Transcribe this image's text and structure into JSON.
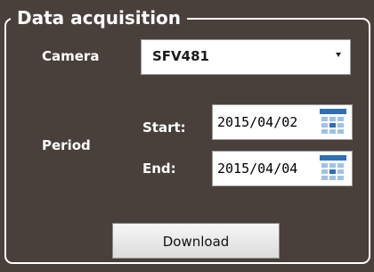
{
  "group": {
    "title": "Data acquisition"
  },
  "camera": {
    "label": "Camera",
    "selected": "SFV481"
  },
  "period": {
    "label": "Period",
    "start_label": "Start:",
    "start_value": "2015/04/02",
    "end_label": "End:",
    "end_value": "2015/04/04"
  },
  "actions": {
    "download_label": "Download"
  },
  "icons": {
    "calendar": "calendar-icon",
    "dropdown": "chevron-down-icon"
  },
  "colors": {
    "panel_background": "#4a403b",
    "accent_blue": "#2f6fb4"
  }
}
